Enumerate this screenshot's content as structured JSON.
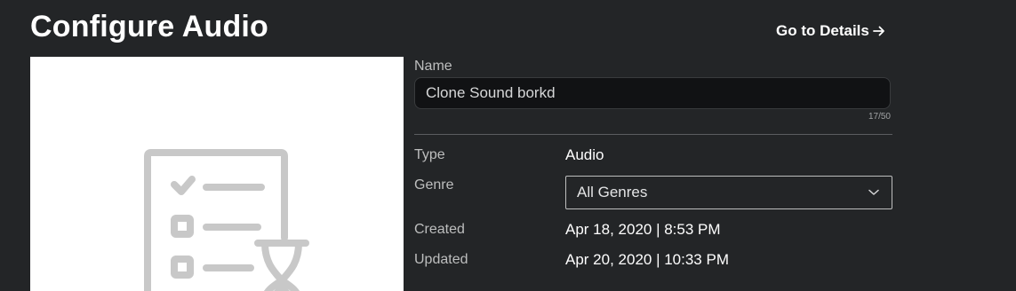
{
  "header": {
    "title": "Configure Audio",
    "details_link": "Go to Details"
  },
  "form": {
    "name": {
      "label": "Name",
      "value": "Clone Sound borkd",
      "count": "17/50"
    },
    "type": {
      "label": "Type",
      "value": "Audio"
    },
    "genre": {
      "label": "Genre",
      "selected": "All Genres"
    },
    "created": {
      "label": "Created",
      "value": "Apr 18, 2020 | 8:53 PM"
    },
    "updated": {
      "label": "Updated",
      "value": "Apr 20, 2020 | 10:33 PM"
    }
  },
  "icons": {
    "details_link": "arrow-right-icon",
    "genre_select": "chevron-down-icon",
    "thumbnail": "checklist-pending-icon"
  },
  "colors": {
    "background": "#232527",
    "thumbnail_bg": "#ffffff",
    "placeholder_icon": "#c8c8c8"
  }
}
